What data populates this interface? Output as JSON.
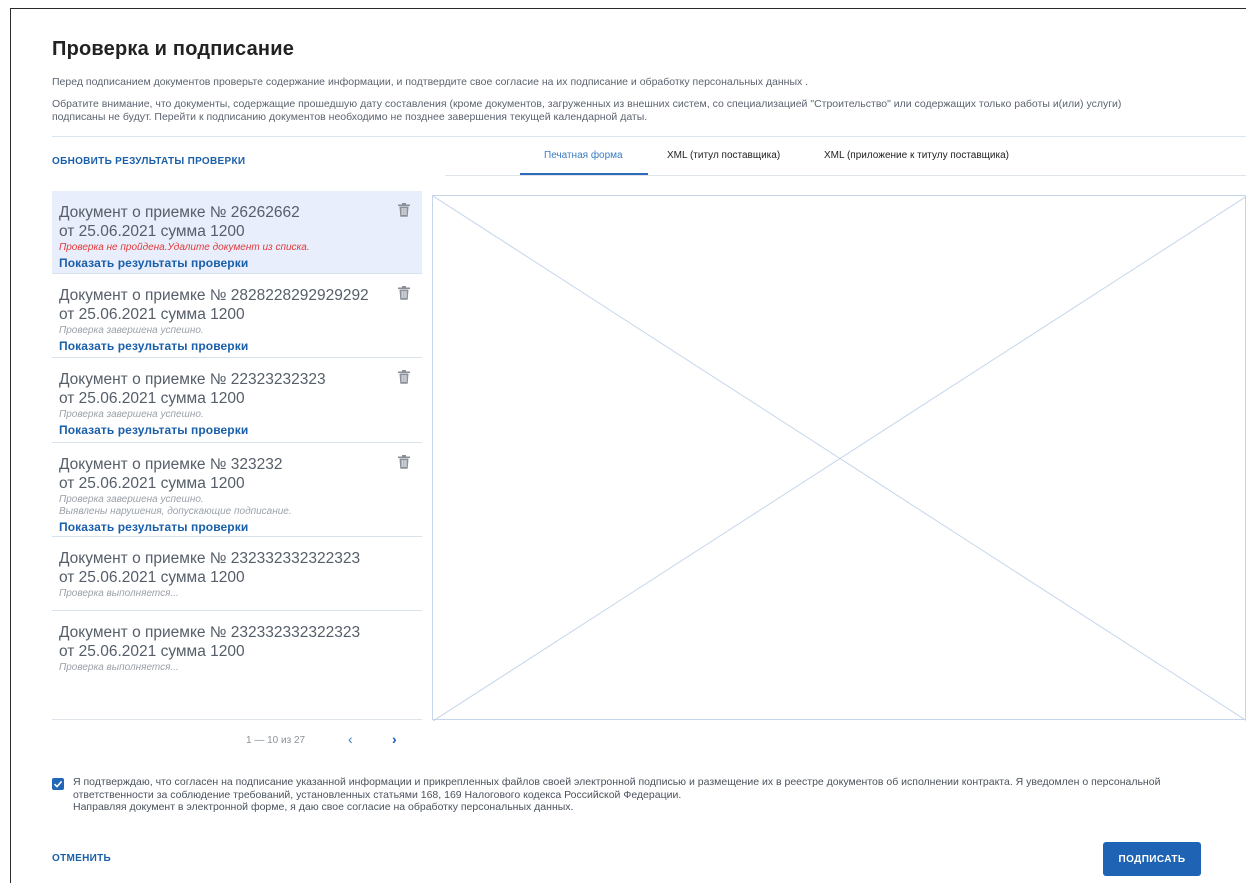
{
  "page": {
    "title": "Проверка и подписание",
    "description_1": "Перед подписанием документов проверьте содержание информации, и подтвердите свое согласие на их подписание и обработку персональных данных .",
    "description_2": "Обратите внимание, что документы, содержащие прошедшую дату составления (кроме документов, загруженных из внешних систем, со специализацией \"Строительство\" или содержащих только работы и(или) услуги)  подписаны не будут. Перейти к подписанию документов необходимо не позднее завершения текущей календарной даты."
  },
  "toolbar": {
    "refresh_label": "ОБНОВИТЬ РЕЗУЛЬТАТЫ ПРОВЕРКИ"
  },
  "tabs": [
    {
      "label": "Печатная форма",
      "active": true
    },
    {
      "label": "XML (титул поставщика)"
    },
    {
      "label": "XML (приложение к титулу поставщика)"
    }
  ],
  "documents": [
    {
      "title_line1": "Документ о приемке № 26262662",
      "title_line2": "от 25.06.2021 сумма 1200",
      "status": "Проверка не пройдена.Удалите документ из списка.",
      "status_type": "error",
      "link": "Показать результаты проверки",
      "deletable": true,
      "selected": true
    },
    {
      "title_line1": "Документ о приемке № 2828228292929292",
      "title_line2": "от 25.06.2021 сумма 1200",
      "status": "Проверка завершена успешно.",
      "link": "Показать результаты проверки",
      "deletable": true
    },
    {
      "title_line1": "Документ о приемке № 22323232323",
      "title_line2": "от 25.06.2021 сумма 1200",
      "status": "Проверка завершена успешно.",
      "link": "Показать результаты проверки",
      "deletable": true
    },
    {
      "title_line1": "Документ о приемке № 323232",
      "title_line2": "от 25.06.2021 сумма 1200",
      "status": "Проверка завершена успешно.",
      "status_extra": "Выявлены нарушения, допускающие подписание.",
      "link": "Показать результаты проверки",
      "deletable": true
    },
    {
      "title_line1": "Документ о приемке № 232332332322323",
      "title_line2": "от 25.06.2021 сумма 1200",
      "status": "Проверка выполняется..."
    },
    {
      "title_line1": "Документ о приемке № 232332332322323",
      "title_line2": "от 25.06.2021 сумма 1200",
      "status": "Проверка выполняется..."
    }
  ],
  "pagination": {
    "range": "1 — 10 из 27",
    "prev_icon": "chevron-left-icon",
    "next_icon": "chevron-right-icon"
  },
  "consent": {
    "checked": true,
    "text_1": "Я подтверждаю, что согласен на подписание указанной информации и прикрепленных файлов своей электронной подписью и размещение их в реестре документов об исполнении контракта. Я уведомлен о персональной ответственности за соблюдение требований, установленных статьями 168, 169 Налогового кодекса Российской Федерации.",
    "text_2": "Направляя документ в электронной форме, я даю свое согласие на обработку персональных данных."
  },
  "actions": {
    "cancel_label": "ОТМЕНИТЬ",
    "sign_label": "ПОДПИСАТЬ"
  },
  "colors": {
    "accent": "#1e63b4",
    "error": "#e23a3a",
    "selected_bg": "#e8eefb"
  }
}
